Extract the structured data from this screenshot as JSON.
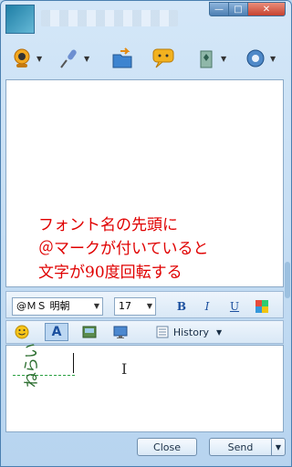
{
  "titlebar": {
    "window_controls": {
      "minimize": "—",
      "maximize": "□",
      "close": "✕"
    }
  },
  "toolbar": {
    "items": [
      {
        "icon": "webcam-icon"
      },
      {
        "icon": "microphone-icon"
      },
      {
        "icon": "send-file-icon"
      },
      {
        "icon": "emoticon-chat-icon"
      },
      {
        "icon": "games-icon"
      },
      {
        "icon": "activities-icon"
      }
    ]
  },
  "conversation": {
    "notice_lines": [
      "フォント名の先頭に",
      "＠マークが付いていると",
      "文字が90度回転する"
    ]
  },
  "format_bar": {
    "font_name": "@ＭＳ 明朝",
    "font_size": "17",
    "bold": "B",
    "italic": "I",
    "underline": "U"
  },
  "edit_bar": {
    "font_button": "A",
    "history_label": "History"
  },
  "input": {
    "typed_text": "ねらい"
  },
  "buttons": {
    "close": "Close",
    "send": "Send"
  },
  "colors": {
    "notice_text": "#e00000",
    "typed_text": "#2c6e30",
    "window_border": "#4a7fb0",
    "close_button": "#c64230"
  }
}
